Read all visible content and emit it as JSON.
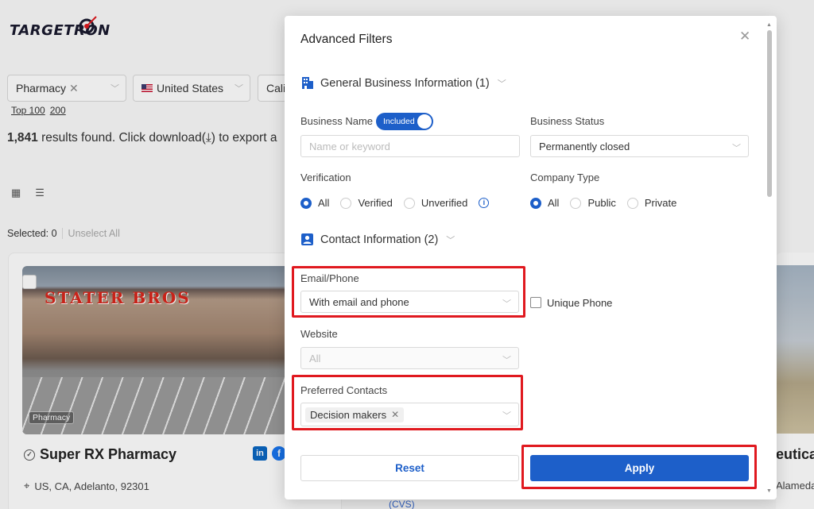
{
  "brand": {
    "logo_text": "TARGETRON"
  },
  "background": {
    "filter_category": {
      "value": "Pharmacy"
    },
    "filter_country": {
      "value": "United States"
    },
    "filter_state": {
      "value": "Cali"
    },
    "quick_links": [
      "Top 100",
      "200"
    ],
    "results": {
      "count": "1,841",
      "text": " results found. Click download(",
      "text_tail": ") to export a"
    },
    "selected": {
      "label": "Selected: 0",
      "unselect": "Unselect All"
    },
    "card": {
      "image_tag": "Pharmacy",
      "store_sign": "STATER BROS",
      "title": "Super RX Pharmacy",
      "address": "US, CA, Adelanto, 92301"
    },
    "right_card": {
      "title_fragment": "eutica",
      "address_fragment": "Alameda"
    },
    "cvs_fragment": "(CVS)"
  },
  "modal": {
    "title": "Advanced Filters",
    "general_section": {
      "title": "General Business Information (1)"
    },
    "business_name": {
      "label": "Business Name",
      "toggle_label": "Included",
      "placeholder": "Name or keyword"
    },
    "business_status": {
      "label": "Business Status",
      "value": "Permanently closed"
    },
    "verification": {
      "label": "Verification",
      "options": [
        "All",
        "Verified",
        "Unverified"
      ],
      "selected": "All"
    },
    "company_type": {
      "label": "Company Type",
      "options": [
        "All",
        "Public",
        "Private"
      ],
      "selected": "All"
    },
    "contact_section": {
      "title": "Contact Information (2)"
    },
    "email_phone": {
      "label": "Email/Phone",
      "value": "With email and phone"
    },
    "unique_phone": {
      "label": "Unique Phone",
      "checked": false
    },
    "website": {
      "label": "Website",
      "value": "All"
    },
    "preferred_contacts": {
      "label": "Preferred Contacts",
      "chips": [
        "Decision makers"
      ]
    },
    "reset_label": "Reset",
    "apply_label": "Apply"
  },
  "colors": {
    "primary": "#1d5fc9",
    "highlight": "#e0191f"
  }
}
